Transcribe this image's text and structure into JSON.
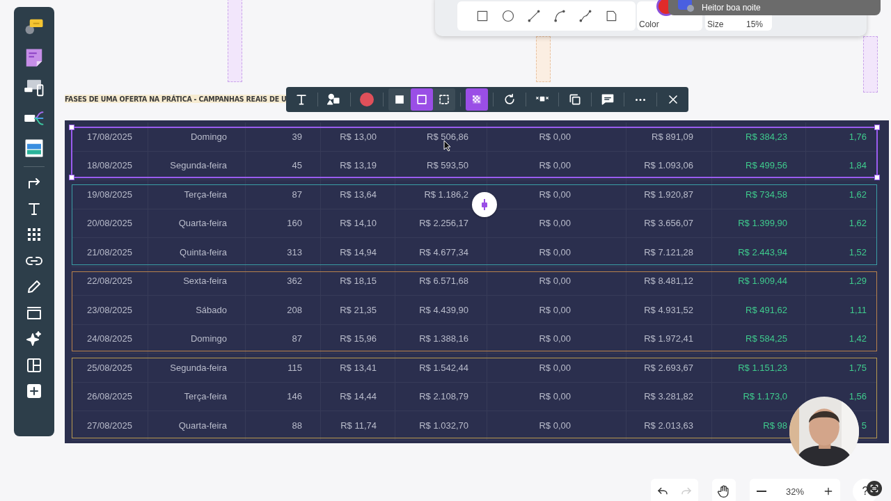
{
  "shape_panel": {
    "color_label": "Color",
    "size_label": "Size",
    "size_value": "15%"
  },
  "notification": {
    "text": "Heitor boa noite"
  },
  "board_title": "FASES DE UMA OFERTA NA PRÁTICA - CAMPANHAS REAIS DE U",
  "toolbar": {
    "color": "#e0505a",
    "fill_styles": [
      {
        "selected": false
      },
      {
        "selected": true
      },
      {
        "selected": false
      }
    ],
    "transparency": {
      "on": true
    }
  },
  "row_groups": [
    {
      "color": "#9a5cf0",
      "selected": true,
      "rows": [
        {
          "cells": [
            "17/08/2025",
            "Domingo",
            "39",
            "R$ 13,00",
            "R$ 506,86",
            "R$ 0,00",
            "R$ 891,09",
            "R$ 384,23",
            "1,76"
          ]
        },
        {
          "cells": [
            "18/08/2025",
            "Segunda-feira",
            "45",
            "R$ 13,19",
            "R$ 593,50",
            "R$ 0,00",
            "R$ 1.093,06",
            "R$ 499,56",
            "1,84"
          ]
        }
      ]
    },
    {
      "color": "#3a9ea6",
      "selected": false,
      "rows": [
        {
          "cells": [
            "19/08/2025",
            "Terça-feira",
            "87",
            "R$ 13,64",
            "R$ 1.186,2",
            "R$ 0,00",
            "R$ 1.920,87",
            "R$ 734,58",
            "1,62"
          ]
        },
        {
          "cells": [
            "20/08/2025",
            "Quarta-feira",
            "160",
            "R$ 14,10",
            "R$ 2.256,17",
            "R$ 0,00",
            "R$ 3.656,07",
            "R$ 1.399,90",
            "1,62"
          ]
        },
        {
          "cells": [
            "21/08/2025",
            "Quinta-feira",
            "313",
            "R$ 14,94",
            "R$ 4.677,34",
            "R$ 0,00",
            "R$ 7.121,28",
            "R$ 2.443,94",
            "1,52"
          ]
        }
      ]
    },
    {
      "color": "#b9824c",
      "selected": false,
      "rows": [
        {
          "cells": [
            "22/08/2025",
            "Sexta-feira",
            "362",
            "R$ 18,15",
            "R$ 6.571,68",
            "R$ 0,00",
            "R$ 8.481,12",
            "R$ 1.909,44",
            "1,29"
          ]
        },
        {
          "cells": [
            "23/08/2025",
            "Sábado",
            "208",
            "R$ 21,35",
            "R$ 4.439,90",
            "R$ 0,00",
            "R$ 4.931,52",
            "R$ 491,62",
            "1,11"
          ]
        },
        {
          "cells": [
            "24/08/2025",
            "Domingo",
            "87",
            "R$ 15,96",
            "R$ 1.388,16",
            "R$ 0,00",
            "R$ 1.972,41",
            "R$ 584,25",
            "1,42"
          ]
        }
      ]
    },
    {
      "color": "#b89a50",
      "selected": false,
      "rows": [
        {
          "cells": [
            "25/08/2025",
            "Segunda-feira",
            "115",
            "R$ 13,41",
            "R$ 1.542,44",
            "R$ 0,00",
            "R$ 2.693,67",
            "R$ 1.151,23",
            "1,75"
          ]
        },
        {
          "cells": [
            "26/08/2025",
            "Terça-feira",
            "146",
            "R$ 14,44",
            "R$ 2.108,79",
            "R$ 0,00",
            "R$ 3.281,82",
            "R$ 1.173,0",
            "1,56"
          ]
        },
        {
          "cells": [
            "27/08/2025",
            "Quarta-feira",
            "88",
            "R$ 11,74",
            "R$ 1.032,70",
            "R$ 0,00",
            "R$ 2.013,63",
            "R$ 98",
            "5"
          ]
        }
      ]
    }
  ],
  "history": {
    "undo": {
      "disabled": false
    },
    "redo": {
      "disabled": true
    }
  },
  "zoom": {
    "value": "32%"
  },
  "help": "?"
}
